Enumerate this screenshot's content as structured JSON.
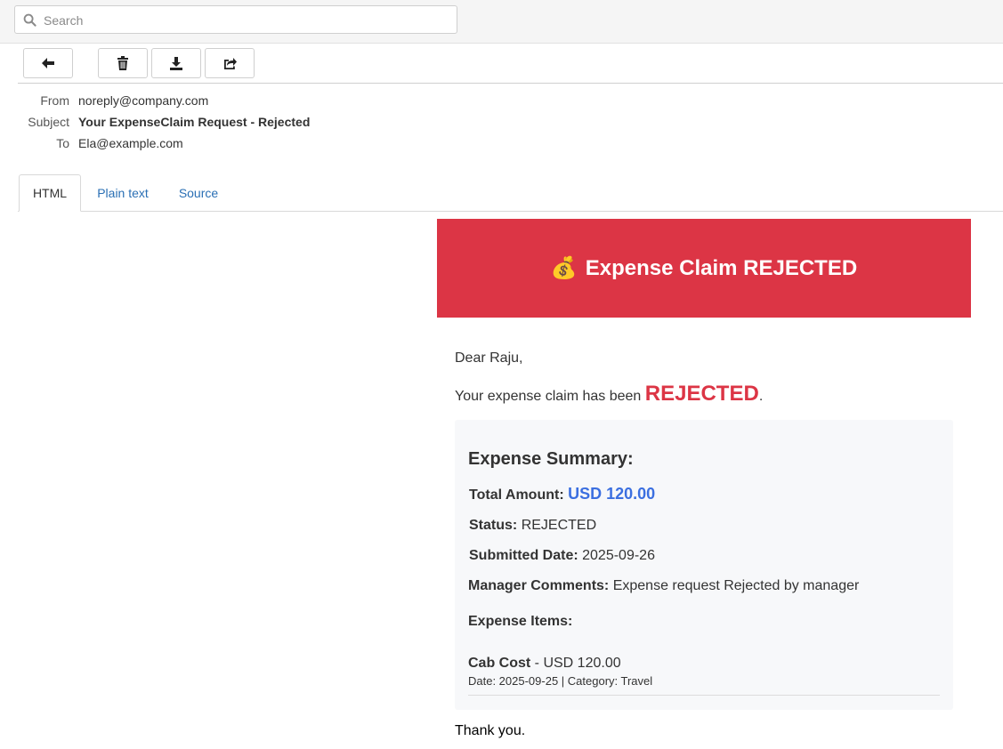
{
  "search": {
    "placeholder": "Search",
    "icon": "search-icon"
  },
  "toolbar": {
    "back_icon": "arrow-left-icon",
    "delete_icon": "trash-icon",
    "download_icon": "download-icon",
    "forward_icon": "forward-icon"
  },
  "headers": {
    "from_label": "From",
    "from_value": "noreply@company.com",
    "subject_label": "Subject",
    "subject_value": "Your ExpenseClaim Request - Rejected",
    "to_label": "To",
    "to_value": "Ela@example.com"
  },
  "tabs": [
    {
      "label": "HTML",
      "active": true
    },
    {
      "label": "Plain text",
      "active": false
    },
    {
      "label": "Source",
      "active": false
    }
  ],
  "email": {
    "banner_emoji": "💰",
    "banner_title": "Expense Claim REJECTED",
    "banner_color": "#dc3545",
    "greeting": "Dear Raju,",
    "status_prefix": "Your expense claim has been ",
    "status_word": "REJECTED",
    "status_suffix": ".",
    "summary": {
      "title": "Expense Summary:",
      "total_label": "Total Amount:",
      "total_value": "USD 120.00",
      "status_label": "Status:",
      "status_value": "REJECTED",
      "submitted_label": "Submitted Date:",
      "submitted_value": "2025-09-26",
      "comments_label": "Manager Comments:",
      "comments_value": "Expense request Rejected by manager",
      "items_title": "Expense Items:",
      "items": [
        {
          "name": "Cab Cost",
          "amount": "USD 120.00",
          "meta": "Date: 2025-09-25 | Category: Travel"
        }
      ]
    },
    "closing": "Thank you."
  }
}
